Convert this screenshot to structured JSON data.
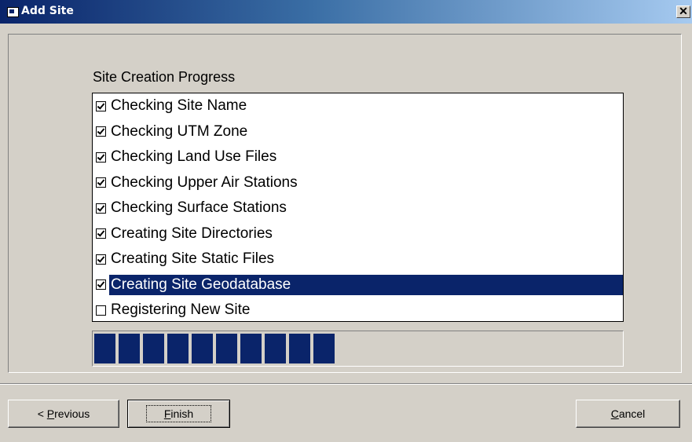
{
  "window": {
    "title": "Add Site",
    "close_glyph": "✕"
  },
  "group_label": "Site Creation Progress",
  "list": [
    {
      "label": "Checking Site Name",
      "checked": true,
      "selected": false
    },
    {
      "label": "Checking UTM Zone",
      "checked": true,
      "selected": false
    },
    {
      "label": "Checking Land Use Files",
      "checked": true,
      "selected": false
    },
    {
      "label": "Checking Upper Air Stations",
      "checked": true,
      "selected": false
    },
    {
      "label": "Checking Surface Stations",
      "checked": true,
      "selected": false
    },
    {
      "label": "Creating Site Directories",
      "checked": true,
      "selected": false
    },
    {
      "label": "Creating Site Static Files",
      "checked": true,
      "selected": false
    },
    {
      "label": "Creating Site Geodatabase",
      "checked": true,
      "selected": true
    },
    {
      "label": "Registering New Site",
      "checked": false,
      "selected": false
    }
  ],
  "progress": {
    "value_fraction": 0.45,
    "filled_blocks": 10,
    "color": "#0a246a"
  },
  "buttons": {
    "previous": {
      "prefix": "< ",
      "accel": "P",
      "rest": "revious"
    },
    "finish": {
      "accel": "F",
      "rest": "inish"
    },
    "cancel": {
      "accel": "C",
      "rest": "ancel"
    }
  },
  "colors": {
    "title_gradient_start": "#0a246a",
    "title_gradient_end": "#a6caf0",
    "selection": "#0a246a",
    "face": "#d4d0c8"
  }
}
